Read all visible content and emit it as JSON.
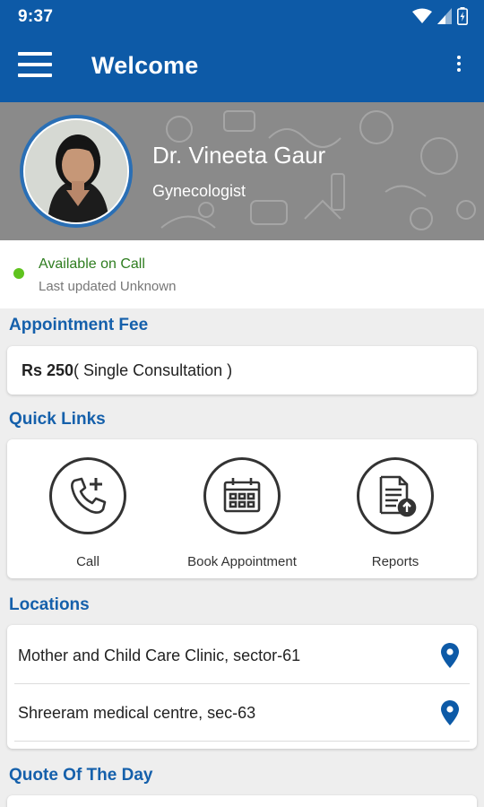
{
  "status_bar": {
    "time": "9:37"
  },
  "app_bar": {
    "title": "Welcome"
  },
  "profile": {
    "name": "Dr. Vineeta Gaur",
    "specialty": "Gynecologist"
  },
  "availability": {
    "status": "Available on Call",
    "last_updated": "Last updated Unknown",
    "status_color": "#5fc31e"
  },
  "appointment_fee": {
    "title": "Appointment Fee",
    "amount": "Rs 250",
    "description": "( Single Consultation )"
  },
  "quick_links": {
    "title": "Quick Links",
    "items": [
      {
        "label": "Call",
        "icon": "phone-plus-icon"
      },
      {
        "label": "Book Appointment",
        "icon": "calendar-icon"
      },
      {
        "label": "Reports",
        "icon": "report-upload-icon"
      }
    ]
  },
  "locations": {
    "title": "Locations",
    "items": [
      {
        "name": "Mother and Child Care Clinic, sector-61",
        "icon": "map-pin-icon"
      },
      {
        "name": "Shreeram medical centre, sec-63",
        "icon": "map-pin-icon"
      }
    ]
  },
  "quote": {
    "title": "Quote Of The Day"
  },
  "colors": {
    "primary": "#0d5aa7",
    "section_title": "#1560ab",
    "pin": "#0d5aa7"
  }
}
